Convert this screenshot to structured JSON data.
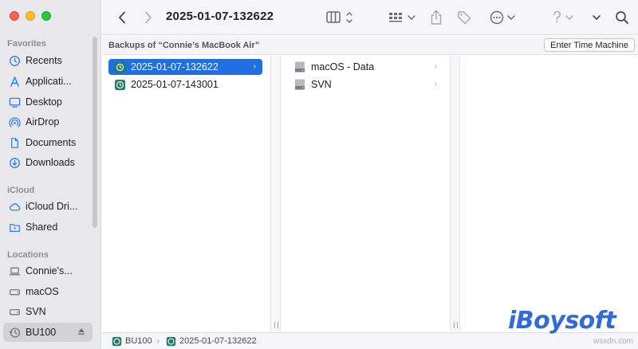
{
  "window": {
    "title": "2025-01-07-132622",
    "accent_color": "#1f6fe2"
  },
  "sidebar": {
    "sections": [
      {
        "title": "Favorites",
        "items": [
          {
            "label": "Recents",
            "icon": "clock-icon"
          },
          {
            "label": "Applicati...",
            "icon": "applications-icon"
          },
          {
            "label": "Desktop",
            "icon": "desktop-icon"
          },
          {
            "label": "AirDrop",
            "icon": "airdrop-icon"
          },
          {
            "label": "Documents",
            "icon": "document-icon"
          },
          {
            "label": "Downloads",
            "icon": "download-icon"
          }
        ]
      },
      {
        "title": "iCloud",
        "items": [
          {
            "label": "iCloud Dri...",
            "icon": "icloud-icon"
          },
          {
            "label": "Shared",
            "icon": "shared-folder-icon"
          }
        ]
      },
      {
        "title": "Locations",
        "items": [
          {
            "label": "Connie's...",
            "icon": "laptop-icon"
          },
          {
            "label": "macOS",
            "icon": "drive-icon"
          },
          {
            "label": "SVN",
            "icon": "drive-icon"
          },
          {
            "label": "BU100",
            "icon": "time-machine-icon",
            "selected": true
          }
        ]
      }
    ]
  },
  "pathrow": {
    "backups_label": "Backups of “Connie’s MacBook Air”",
    "enter_time_machine": "Enter Time Machine"
  },
  "columns": {
    "col1": [
      {
        "label": "2025-01-07-132622",
        "icon": "time-machine-backup-icon",
        "selected": true
      },
      {
        "label": "2025-01-07-143001",
        "icon": "time-machine-backup-icon",
        "selected": false
      }
    ],
    "col2": [
      {
        "label": "macOS - Data",
        "icon": "drive-icon"
      },
      {
        "label": "SVN",
        "icon": "drive-icon"
      }
    ]
  },
  "statusbar": {
    "path": [
      "BU100",
      "2025-01-07-132622"
    ]
  },
  "watermark": {
    "brand": "iBoysoft",
    "site": "wsxdn.com"
  }
}
